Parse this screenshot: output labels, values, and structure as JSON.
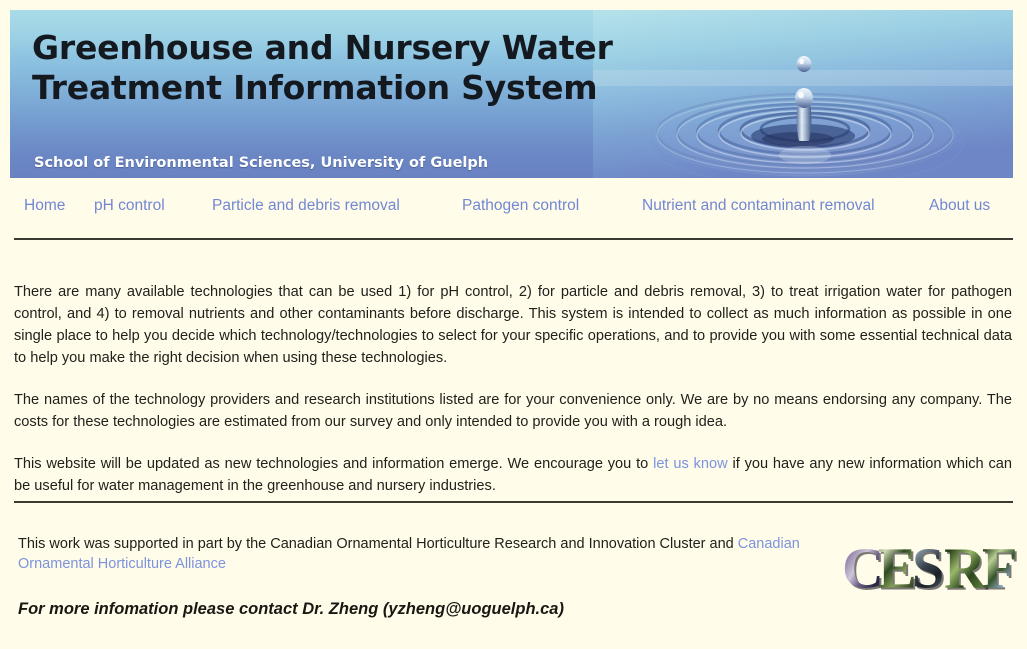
{
  "banner": {
    "title_line1": "Greenhouse and Nursery Water",
    "title_line2": "Treatment Information System",
    "subtitle": "School of Environmental Sciences, University of Guelph",
    "photo_alt": "water-droplet-ripple-photo",
    "gradient_top": "#a9dce8",
    "gradient_bottom": "#6b82c2"
  },
  "nav": {
    "items": [
      {
        "label": "Home"
      },
      {
        "label": "pH control"
      },
      {
        "label": "Particle and debris removal"
      },
      {
        "label": "Pathogen control"
      },
      {
        "label": "Nutrient and contaminant removal"
      },
      {
        "label": "About us"
      }
    ],
    "link_color": "#7287d4"
  },
  "content": {
    "paragraph1_part1": "There are many available technologies that can be used 1) for pH control, 2) for particle and debris removal, 3) to treat irrigation water for pathogen control, and 4) to removal nutrients and other contaminants before discharge. This system is intended to collect as much information as possible in one single place to help you decide which technology/technologies to select for your specific operations, and to provide you with some essential technical data to help you make the right decision when using these technologies.",
    "paragraph2": "The names of the technology providers and research institutions listed are for your convenience only. We are by no means endorsing any company. The costs for these technologies are estimated from our survey and only intended to provide you with a rough idea.",
    "paragraph3_before": "This website will be updated as new technologies and information emerge. We encourage you to ",
    "paragraph3_link": "let us know",
    "paragraph3_after": " if you have any new information which can be useful for water management in the greenhouse and nursery industries.",
    "link_color": "#7d92dd"
  },
  "footer": {
    "credit_text": "This work was supported in part by the Canadian Ornamental Horticulture Research and Innovation Cluster and ",
    "credit_link": "Canadian Ornamental Horticulture Alliance",
    "contact": "For more infomation please contact Dr. Zheng (yzheng@uoguelph.ca)",
    "logo_text": "CESRF"
  },
  "page": {
    "background_color": "#fffdea",
    "rule_color": "#3a3a33"
  }
}
